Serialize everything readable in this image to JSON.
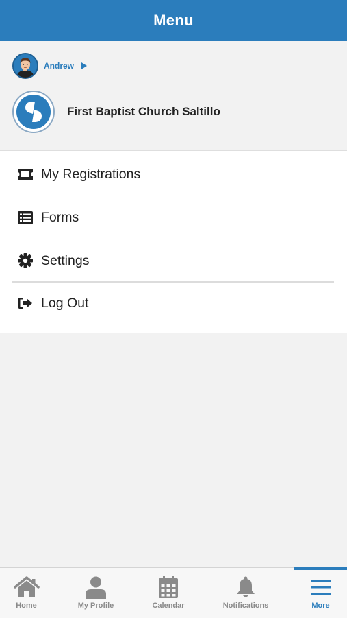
{
  "header": {
    "title": "Menu"
  },
  "profile": {
    "user_name": "Andrew",
    "church_name": "First Baptist Church Saltillo"
  },
  "menu": {
    "items": [
      {
        "label": "My Registrations",
        "icon": "ticket-icon"
      },
      {
        "label": "Forms",
        "icon": "list-icon"
      },
      {
        "label": "Settings",
        "icon": "gear-icon"
      },
      {
        "label": "Log Out",
        "icon": "sign-out-icon"
      }
    ]
  },
  "tabs": [
    {
      "label": "Home",
      "icon": "home-icon"
    },
    {
      "label": "My Profile",
      "icon": "person-icon"
    },
    {
      "label": "Calendar",
      "icon": "calendar-icon"
    },
    {
      "label": "Notifications",
      "icon": "bell-icon"
    },
    {
      "label": "More",
      "icon": "hamburger-icon",
      "active": true
    }
  ],
  "colors": {
    "accent": "#2b7dbc",
    "background": "#f2f2f2",
    "tab_inactive": "#8a8a8a",
    "text": "#222222"
  }
}
